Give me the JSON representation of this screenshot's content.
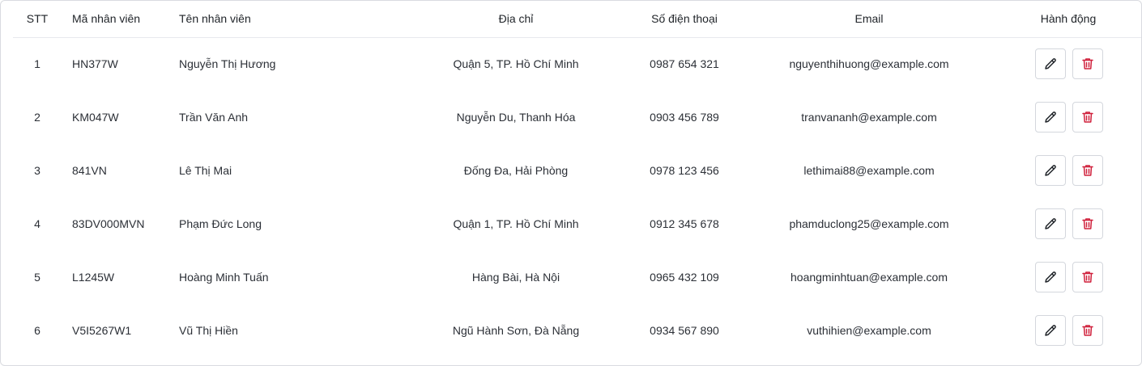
{
  "table": {
    "headers": {
      "stt": "STT",
      "code": "Mã nhân viên",
      "name": "Tên nhân viên",
      "address": "Địa chỉ",
      "phone": "Số điện thoại",
      "email": "Email",
      "actions": "Hành động"
    },
    "rows": [
      {
        "stt": "1",
        "code": "HN377W",
        "name": "Nguyễn Thị Hương",
        "address": "Quận 5, TP. Hồ Chí Minh",
        "phone": "0987 654 321",
        "email": "nguyenthihuong@example.com"
      },
      {
        "stt": "2",
        "code": "KM047W",
        "name": "Trần Văn Anh",
        "address": "Nguyễn Du, Thanh Hóa",
        "phone": "0903 456 789",
        "email": "tranvananh@example.com"
      },
      {
        "stt": "3",
        "code": "841VN",
        "name": "Lê Thị Mai",
        "address": "Đống Đa, Hải Phòng",
        "phone": "0978 123 456",
        "email": "lethimai88@example.com"
      },
      {
        "stt": "4",
        "code": "83DV000MVN",
        "name": "Phạm Đức Long",
        "address": "Quận 1, TP. Hồ Chí Minh",
        "phone": "0912 345 678",
        "email": "phamduclong25@example.com"
      },
      {
        "stt": "5",
        "code": "L1245W",
        "name": "Hoàng Minh Tuấn",
        "address": "Hàng Bài, Hà Nội",
        "phone": "0965 432 109",
        "email": "hoangminhtuan@example.com"
      },
      {
        "stt": "6",
        "code": "V5I5267W1",
        "name": "Vũ Thị Hiền",
        "address": "Ngũ Hành Sơn, Đà Nẵng",
        "phone": "0934 567 890",
        "email": "vuthihien@example.com"
      }
    ],
    "action_icons": {
      "edit": "pencil-icon",
      "delete": "trash-icon"
    }
  },
  "colors": {
    "edit_icon": "#1f2328",
    "delete_icon": "#d0213c",
    "border": "#d4d7dd"
  }
}
